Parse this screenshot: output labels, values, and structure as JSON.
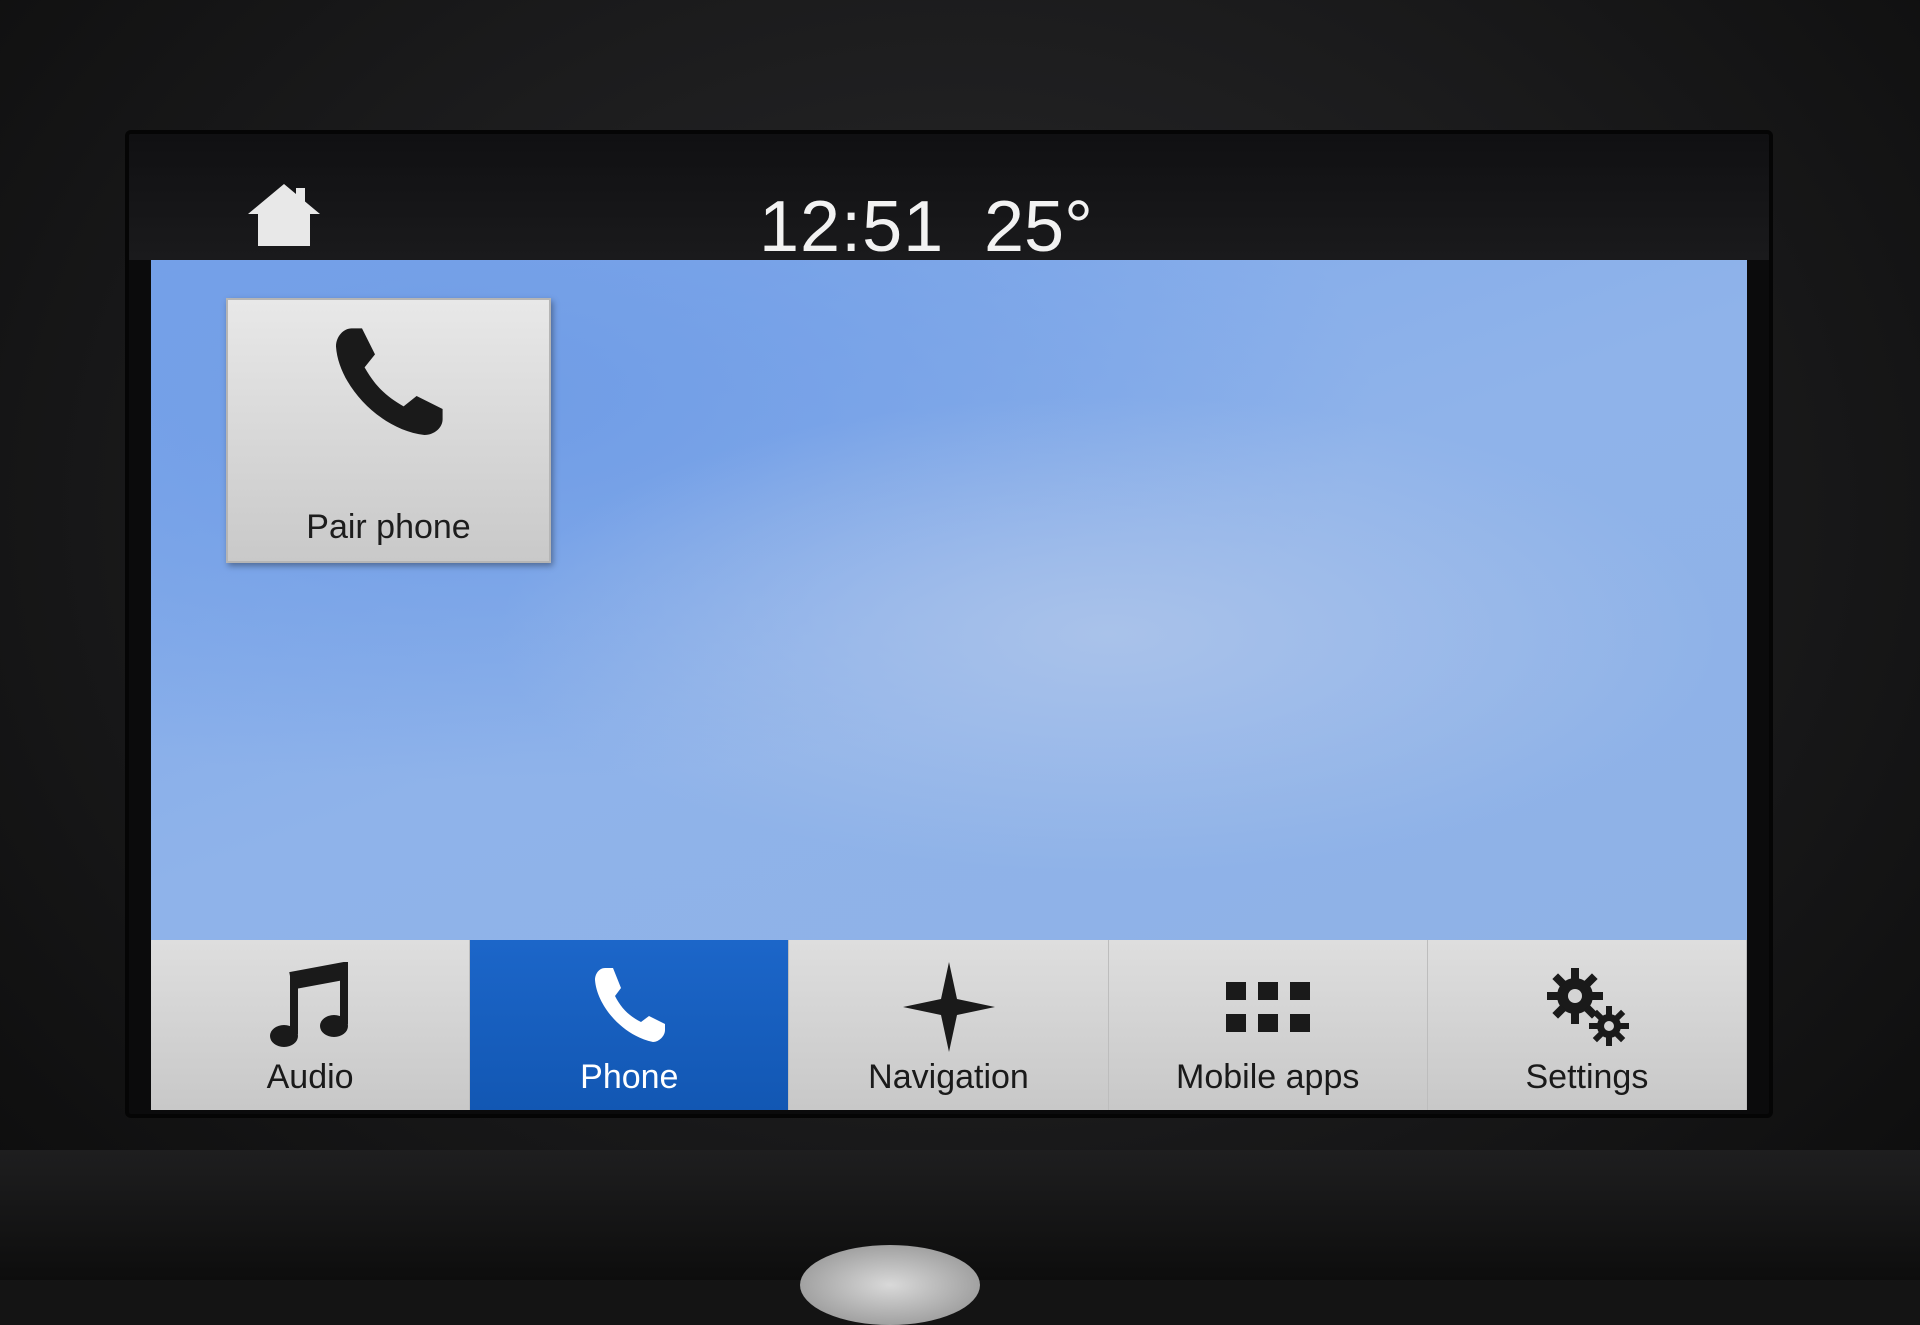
{
  "status": {
    "time": "12:51",
    "temperature": "25°"
  },
  "tiles": [
    {
      "label": "Pair phone",
      "icon": "phone-icon"
    }
  ],
  "nav": {
    "active": "Phone",
    "items": [
      {
        "label": "Audio",
        "icon": "music-note-icon"
      },
      {
        "label": "Phone",
        "icon": "phone-icon"
      },
      {
        "label": "Navigation",
        "icon": "navigation-star-icon"
      },
      {
        "label": "Mobile apps",
        "icon": "apps-grid-icon"
      },
      {
        "label": "Settings",
        "icon": "gears-icon"
      }
    ]
  },
  "colors": {
    "active_tab": "#1c66c9",
    "background": "#8fb3ea",
    "bar": "#d6d6d6"
  }
}
